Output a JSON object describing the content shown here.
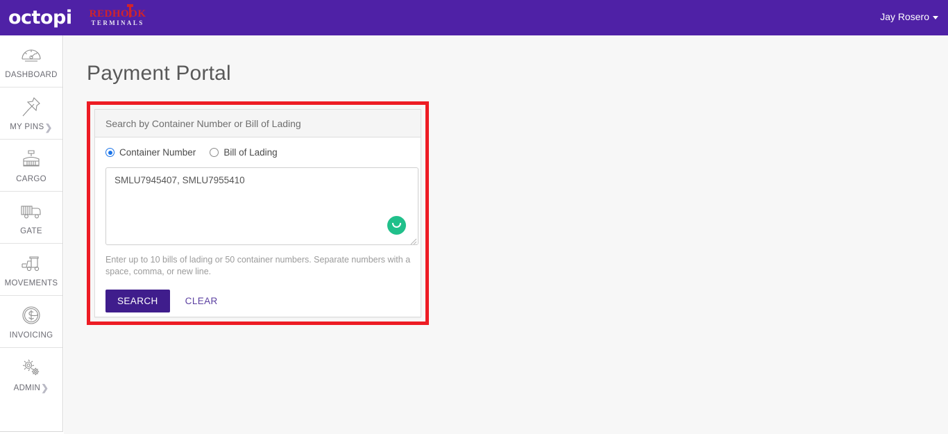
{
  "header": {
    "brand": "octopi",
    "tenant_logo_top": "REDHOOK",
    "tenant_logo_bottom": "TERMINALS",
    "user_name": "Jay Rosero",
    "bg_color": "#4f21a6"
  },
  "sidebar": {
    "items": [
      {
        "label": "DASHBOARD",
        "icon": "gauge-icon",
        "chevron": ""
      },
      {
        "label": "MY PINS",
        "icon": "pin-icon",
        "chevron": "❯"
      },
      {
        "label": "CARGO",
        "icon": "container-icon",
        "chevron": ""
      },
      {
        "label": "GATE",
        "icon": "truck-icon",
        "chevron": ""
      },
      {
        "label": "MOVEMENTS",
        "icon": "forklift-icon",
        "chevron": ""
      },
      {
        "label": "INVOICING",
        "icon": "dollar-coin-icon",
        "chevron": ""
      },
      {
        "label": "ADMIN",
        "icon": "gears-icon",
        "chevron": "❯"
      }
    ]
  },
  "main": {
    "page_title": "Payment Portal",
    "panel": {
      "header": "Search by Container Number or Bill of Lading",
      "radios": [
        {
          "label": "Container Number",
          "selected": true
        },
        {
          "label": "Bill of Lading",
          "selected": false
        }
      ],
      "textarea": {
        "value": "SMLU7945407, SMLU7955410",
        "placeholder": ""
      },
      "assistant_badge": "grammarly-icon",
      "hint": "Enter up to 10 bills of lading or 50 container numbers. Separate numbers with a space, comma, or new line.",
      "buttons": {
        "search": "SEARCH",
        "clear": "CLEAR"
      }
    },
    "highlight_color": "#ed1c24"
  }
}
